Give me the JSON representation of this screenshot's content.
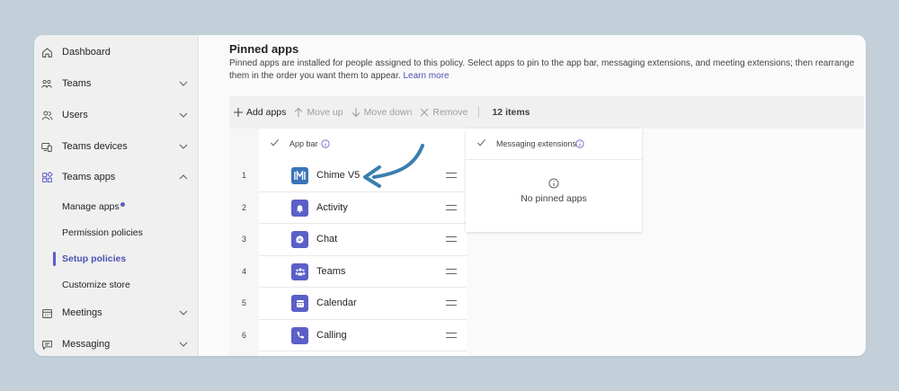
{
  "sidebar": {
    "items": [
      {
        "label": "Dashboard",
        "icon": "home-icon"
      },
      {
        "label": "Teams",
        "icon": "teams-icon"
      },
      {
        "label": "Users",
        "icon": "users-icon"
      },
      {
        "label": "Teams devices",
        "icon": "devices-icon"
      },
      {
        "label": "Teams apps",
        "icon": "apps-icon"
      },
      {
        "label": "Meetings",
        "icon": "calendar-icon"
      },
      {
        "label": "Messaging",
        "icon": "message-icon"
      }
    ],
    "subitems": [
      {
        "label": "Manage apps"
      },
      {
        "label": "Permission policies"
      },
      {
        "label": "Setup policies"
      },
      {
        "label": "Customize store"
      }
    ]
  },
  "main": {
    "title": "Pinned apps",
    "description": "Pinned apps are installed for people assigned to this policy. Select apps to pin to the app bar, messaging extensions, and meeting extensions; then rearrange them in the order you want them to appear.",
    "learn_more": "Learn more"
  },
  "toolbar": {
    "add_apps": "Add apps",
    "move_up": "Move up",
    "move_down": "Move down",
    "remove": "Remove",
    "count": "12 items"
  },
  "app_bar": {
    "header": "App bar",
    "rows": [
      {
        "num": "1",
        "name": "Chime V5",
        "icon": "chime-icon",
        "color": "#3b74b8"
      },
      {
        "num": "2",
        "name": "Activity",
        "icon": "bell-icon",
        "color": "#5b5fc7"
      },
      {
        "num": "3",
        "name": "Chat",
        "icon": "chat-icon",
        "color": "#5b5fc7"
      },
      {
        "num": "4",
        "name": "Teams",
        "icon": "teams-icon",
        "color": "#5b5fc7"
      },
      {
        "num": "5",
        "name": "Calendar",
        "icon": "calendar-icon",
        "color": "#5b5fc7"
      },
      {
        "num": "6",
        "name": "Calling",
        "icon": "phone-icon",
        "color": "#5b5fc7"
      }
    ]
  },
  "messaging_extensions": {
    "header": "Messaging extensions",
    "empty": "No pinned apps"
  },
  "colors": {
    "accent": "#5b5fc7",
    "arrow": "#3a7eb0"
  }
}
